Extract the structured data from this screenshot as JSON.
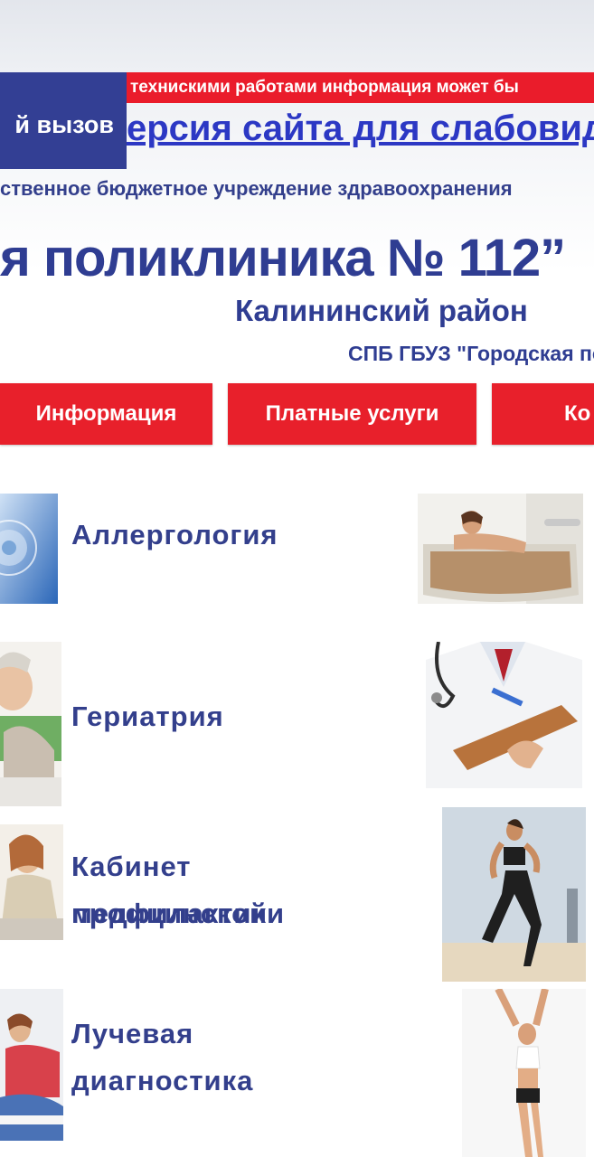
{
  "ticker_text": "технискими работами информация может бы",
  "emergency_label": "й вызов",
  "visually_impaired_link": "ерсия сайта для слабовидя",
  "org_line": "ственное бюджетное учреждение здравоохранения",
  "clinic_name": "я поликлиника № 112”",
  "district": "Калининский район",
  "short_name": "СПБ ГБУЗ \"Городская по",
  "nav": [
    {
      "label": "Информация"
    },
    {
      "label": "Платные услуги"
    },
    {
      "label": "Ко"
    }
  ],
  "services": [
    {
      "label_lines": [
        "Аллергология"
      ]
    },
    {
      "label_lines": [
        "Гериатрия"
      ]
    },
    {
      "label_lines": [
        "Кабинет медицинской",
        "профилактики"
      ]
    },
    {
      "label_lines": [
        "Лучевая",
        "диагностика"
      ]
    }
  ],
  "icons": {
    "allergy": "dandelion-photo",
    "geriatrics": "elderly-man-photo",
    "prophylaxis": "woman-writing-photo",
    "radiology": "patient-care-photo",
    "bath": "bath-therapy-photo",
    "doctor": "doctor-clipboard-photo",
    "runner": "runner-photo",
    "stretch": "stretching-woman-photo"
  },
  "colors": {
    "brand_blue": "#2f3d92",
    "accent_red": "#e8202b",
    "link_blue": "#2c38c4"
  }
}
